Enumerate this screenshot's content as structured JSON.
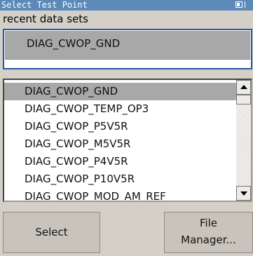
{
  "window": {
    "title": "Select Test Point"
  },
  "recent": {
    "label": "recent data sets",
    "selected": "DIAG_CWOP_GND"
  },
  "list": {
    "items": [
      "DIAG_CWOP_GND",
      "DIAG_CWOP_TEMP_OP3",
      "DIAG_CWOP_P5V5R",
      "DIAG_CWOP_M5V5R",
      "DIAG_CWOP_P4V5R",
      "DIAG_CWOP_P10V5R",
      "DIAG_CWOP_MOD_AM_REF"
    ],
    "selected_index": 0
  },
  "buttons": {
    "select": "Select",
    "file_manager_line1": "File",
    "file_manager_line2": "Manager..."
  }
}
